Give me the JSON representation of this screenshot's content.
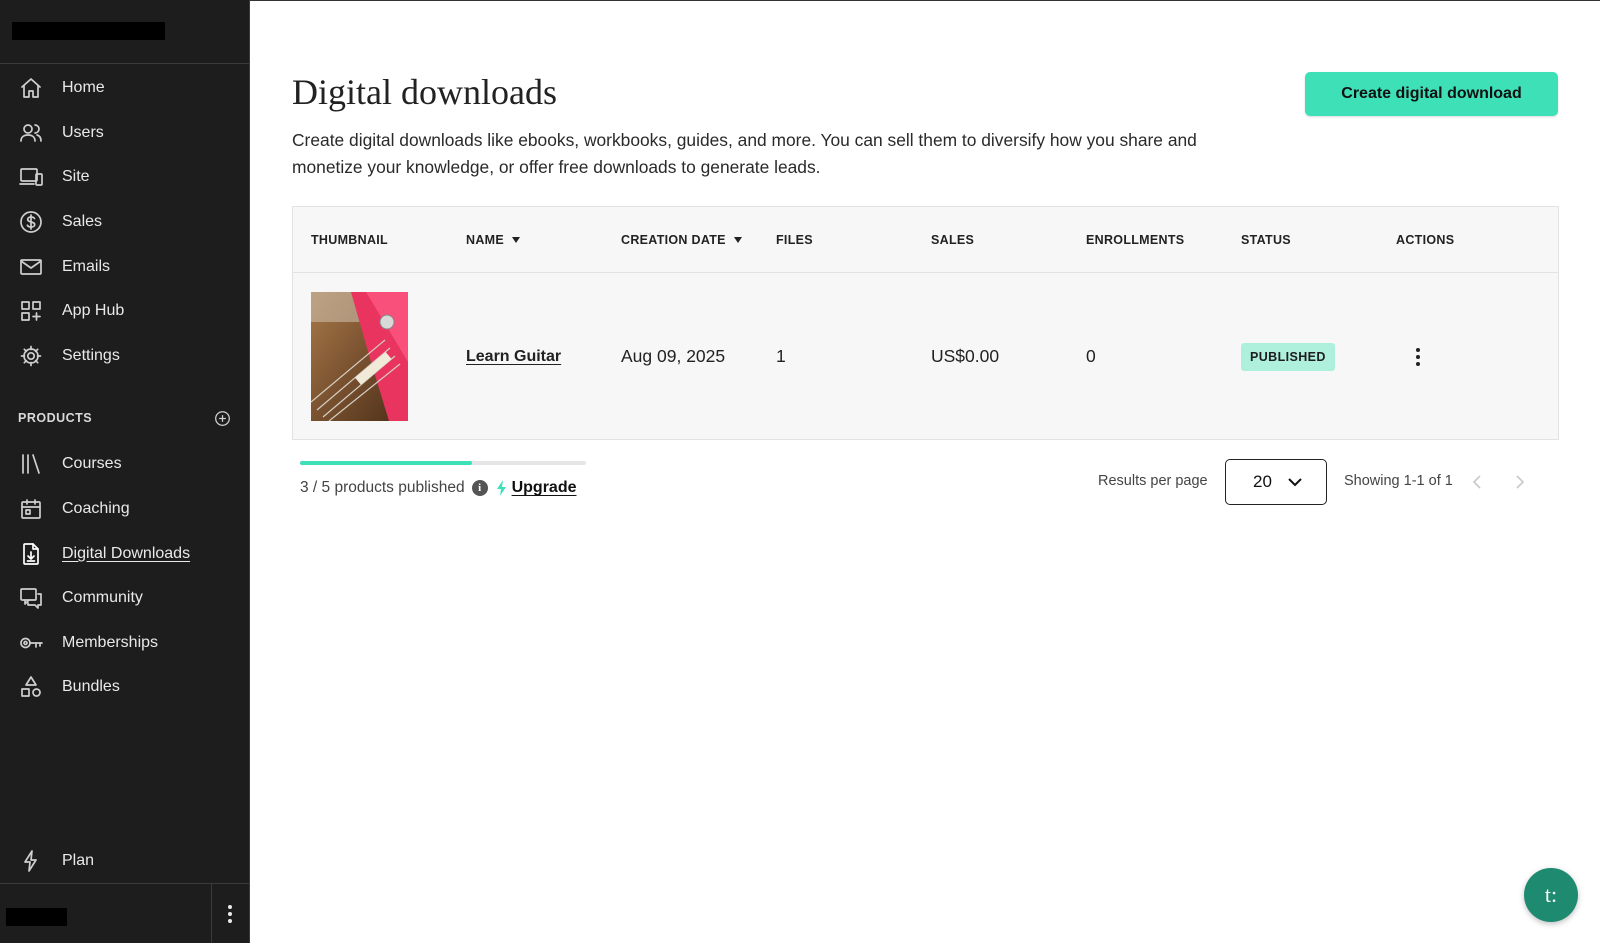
{
  "sidebar": {
    "nav": [
      {
        "label": "Home",
        "icon": "home-icon"
      },
      {
        "label": "Users",
        "icon": "users-icon"
      },
      {
        "label": "Site",
        "icon": "site-icon"
      },
      {
        "label": "Sales",
        "icon": "dollar-icon"
      },
      {
        "label": "Emails",
        "icon": "mail-icon"
      },
      {
        "label": "App Hub",
        "icon": "app-grid-icon"
      },
      {
        "label": "Settings",
        "icon": "gear-icon"
      }
    ],
    "products_section": {
      "title": "PRODUCTS",
      "items": [
        {
          "label": "Courses",
          "icon": "books-icon"
        },
        {
          "label": "Coaching",
          "icon": "calendar-icon"
        },
        {
          "label": "Digital Downloads",
          "icon": "file-download-icon",
          "active": true
        },
        {
          "label": "Community",
          "icon": "chat-icon"
        },
        {
          "label": "Memberships",
          "icon": "key-icon"
        },
        {
          "label": "Bundles",
          "icon": "shapes-icon"
        }
      ]
    },
    "plan_label": "Plan"
  },
  "page": {
    "title": "Digital downloads",
    "description": "Create digital downloads like ebooks, workbooks, guides, and more. You can sell them to diversify how you share and monetize your knowledge, or offer free downloads to generate leads.",
    "create_button": "Create digital download"
  },
  "table": {
    "columns": [
      "THUMBNAIL",
      "NAME",
      "CREATION DATE",
      "FILES",
      "SALES",
      "ENROLLMENTS",
      "STATUS",
      "ACTIONS"
    ],
    "rows": [
      {
        "name": "Learn Guitar",
        "creation_date": "Aug 09, 2025",
        "files": "1",
        "sales": "US$0.00",
        "enrollments": "0",
        "status": "PUBLISHED"
      }
    ]
  },
  "footer": {
    "published_text": "3 / 5 products published",
    "published_fraction": 0.6,
    "upgrade_label": "Upgrade",
    "results_per_page_label": "Results per page",
    "results_per_page_value": "20",
    "showing_text": "Showing 1-1 of 1"
  },
  "chat_button_label": "t:",
  "colors": {
    "sidebar_bg": "#1d1d1d",
    "accent": "#3ee0b8",
    "badge_bg": "#aef0dc",
    "chat_bg": "#1e8a6f"
  }
}
